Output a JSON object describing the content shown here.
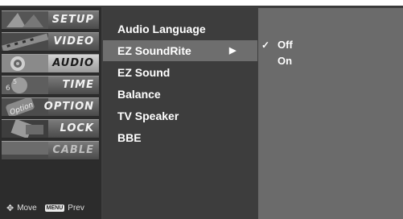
{
  "sidebar": {
    "items": [
      {
        "label": "SETUP",
        "state": "normal"
      },
      {
        "label": "VIDEO",
        "state": "normal"
      },
      {
        "label": "AUDIO",
        "state": "active"
      },
      {
        "label": "TIME",
        "state": "normal"
      },
      {
        "label": "OPTION",
        "state": "normal"
      },
      {
        "label": "LOCK",
        "state": "normal"
      },
      {
        "label": "CABLE",
        "state": "disabled"
      }
    ],
    "hints": {
      "move_icon": "move-arrows-icon",
      "move_label": "Move",
      "menu_key": "MENU",
      "prev_label": "Prev"
    }
  },
  "main_menu": {
    "items": [
      {
        "label": "Audio Language"
      },
      {
        "label": "EZ SoundRite",
        "selected": true,
        "arrow": "▶"
      },
      {
        "label": "EZ Sound"
      },
      {
        "label": "Balance"
      },
      {
        "label": "TV Speaker"
      },
      {
        "label": "BBE"
      }
    ]
  },
  "sub_menu": {
    "options": [
      {
        "label": "Off",
        "checked": true,
        "check_mark": "✓"
      },
      {
        "label": "On",
        "checked": false,
        "check_mark": ""
      }
    ]
  },
  "colors": {
    "frame": "#3f3f3f",
    "sidebar": "#2c2c2c",
    "main_panel": "#3d3d3d",
    "selected_row": "#6e6e6e",
    "sub_panel": "#6b6b6b",
    "text": "#ffffff"
  }
}
